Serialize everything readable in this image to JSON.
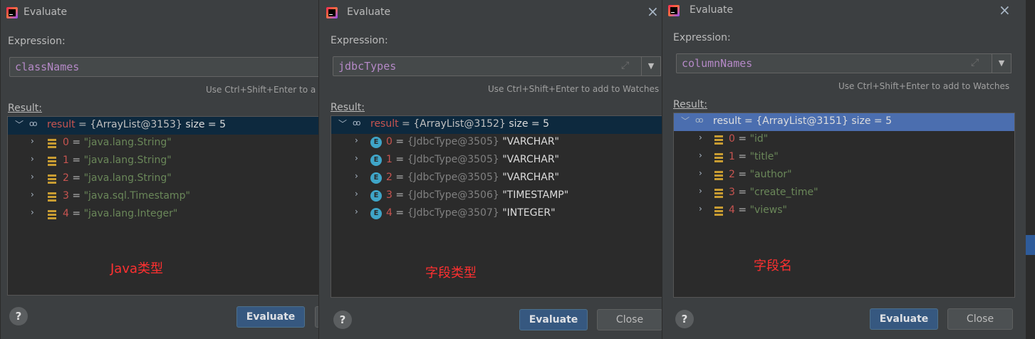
{
  "colors": {
    "accent": "#4b6eaf",
    "primary_button": "#365880",
    "annotation": "#ff3030"
  },
  "dialogs": [
    {
      "title": "Evaluate",
      "expression_label": "Expression:",
      "expression": "classNames",
      "hint": "Use Ctrl+Shift+Enter to a",
      "result_label": "Result:",
      "result_row": {
        "name": "result",
        "eq": " = ",
        "type": "{ArrayList@3153}",
        "extra": " size = 5"
      },
      "items": [
        {
          "name": "0",
          "eq": " = ",
          "value": "\"java.lang.String\""
        },
        {
          "name": "1",
          "eq": " = ",
          "value": "\"java.lang.String\""
        },
        {
          "name": "2",
          "eq": " = ",
          "value": "\"java.lang.String\""
        },
        {
          "name": "3",
          "eq": " = ",
          "value": "\"java.sql.Timestamp\""
        },
        {
          "name": "4",
          "eq": " = ",
          "value": "\"java.lang.Integer\""
        }
      ],
      "annotation": "Java类型",
      "help": "?",
      "evaluate_button": "Evaluate"
    },
    {
      "title": "Evaluate",
      "close_icon": "×",
      "expression_label": "Expression:",
      "expression": "jdbcTypes",
      "hint": "Use Ctrl+Shift+Enter to add to Watches",
      "result_label": "Result:",
      "result_row": {
        "name": "result",
        "eq": " = ",
        "type": "{ArrayList@3152}",
        "extra": " size = 5"
      },
      "items": [
        {
          "name": "0",
          "eq": " = ",
          "type": "{JdbcType@3505}",
          "value": " \"VARCHAR\""
        },
        {
          "name": "1",
          "eq": " = ",
          "type": "{JdbcType@3505}",
          "value": " \"VARCHAR\""
        },
        {
          "name": "2",
          "eq": " = ",
          "type": "{JdbcType@3505}",
          "value": " \"VARCHAR\""
        },
        {
          "name": "3",
          "eq": " = ",
          "type": "{JdbcType@3506}",
          "value": " \"TIMESTAMP\""
        },
        {
          "name": "4",
          "eq": " = ",
          "type": "{JdbcType@3507}",
          "value": " \"INTEGER\""
        }
      ],
      "enum_letter": "E",
      "annotation": "字段类型",
      "help": "?",
      "evaluate_button": "Evaluate",
      "close_button": "Close"
    },
    {
      "title": "Evaluate",
      "close_icon": "×",
      "expression_label": "Expression:",
      "expression": "columnNames",
      "hint": "Use Ctrl+Shift+Enter to add to Watches",
      "result_label": "Result:",
      "result_row": {
        "name": "result",
        "eq": " = ",
        "type": "{ArrayList@3151}",
        "extra": " size = 5"
      },
      "items": [
        {
          "name": "0",
          "eq": " = ",
          "value": "\"id\""
        },
        {
          "name": "1",
          "eq": " = ",
          "value": "\"title\""
        },
        {
          "name": "2",
          "eq": " = ",
          "value": "\"author\""
        },
        {
          "name": "3",
          "eq": " = ",
          "value": "\"create_time\""
        },
        {
          "name": "4",
          "eq": " = ",
          "value": "\"views\""
        }
      ],
      "annotation": "字段名",
      "help": "?",
      "evaluate_button": "Evaluate",
      "close_button": "Close"
    }
  ]
}
